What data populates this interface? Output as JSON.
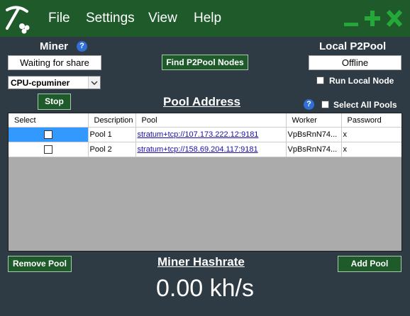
{
  "menu": {
    "file": "File",
    "settings": "Settings",
    "view": "View",
    "help": "Help"
  },
  "window_controls": {
    "minimize": "minimize-icon",
    "maximize": "plus-icon",
    "close": "close-icon"
  },
  "miner": {
    "title": "Miner",
    "status_button": "Waiting for share",
    "selected_miner": "CPU-cpuminer",
    "stop_button": "Stop"
  },
  "find_nodes_button": "Find P2Pool Nodes",
  "local_p2pool": {
    "title": "Local P2Pool",
    "status_button": "Offline",
    "run_local_node": "Run Local Node"
  },
  "pool_address": {
    "title": "Pool Address",
    "select_all": "Select All Pools"
  },
  "table": {
    "columns": [
      "Select",
      "Description",
      "Pool",
      "Worker",
      "Password"
    ],
    "rows": [
      {
        "description": "Pool 1",
        "pool": "stratum+tcp://107.173.222.12:9181",
        "worker": "VpBsRnN74...",
        "password": "x"
      },
      {
        "description": "Pool 2",
        "pool": "stratum+tcp://158.69.204.117:9181",
        "worker": "VpBsRnN74...",
        "password": "x"
      }
    ]
  },
  "remove_pool_button": "Remove Pool",
  "add_pool_button": "Add Pool",
  "hashrate": {
    "title": "Miner Hashrate",
    "value": "0.00 kh/s"
  },
  "colors": {
    "titlebar": "#1e5a2a",
    "background": "#2e3b44",
    "accent_green": "#25a83a",
    "help_blue": "#2f6fd6"
  }
}
